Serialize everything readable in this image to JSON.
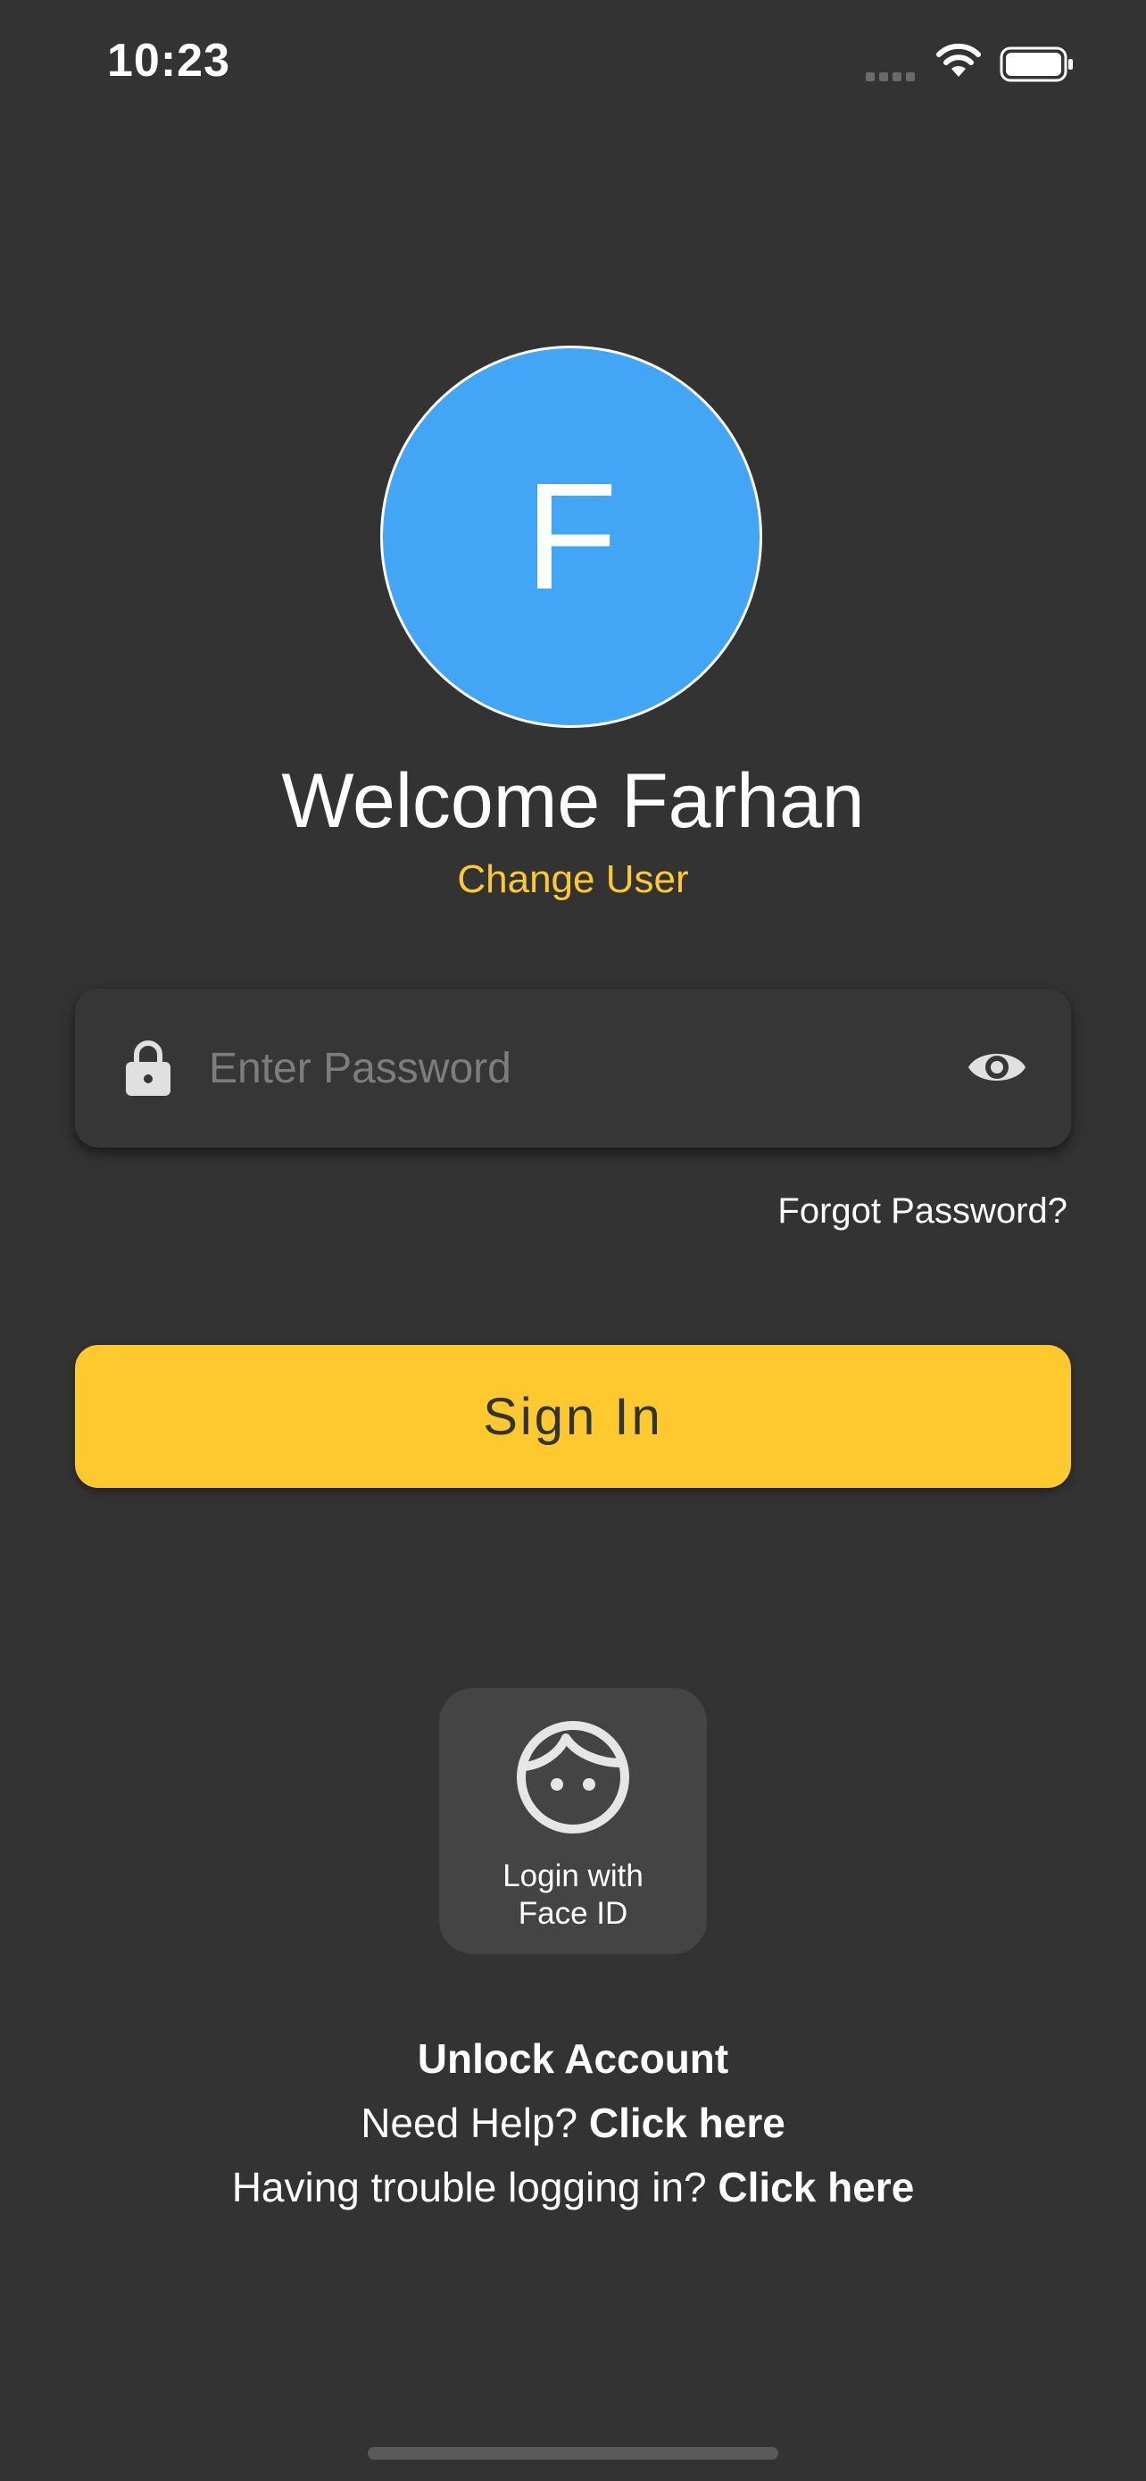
{
  "status_bar": {
    "time": "10:23",
    "signal_icon": "cellular-signal-icon",
    "wifi_icon": "wifi-icon",
    "battery_icon": "battery-full-icon"
  },
  "profile": {
    "initial": "F",
    "avatar_color": "#42a5f5",
    "welcome_text": "Welcome Farhan",
    "change_user_label": "Change User"
  },
  "password": {
    "placeholder": "Enter Password",
    "value": "",
    "lock_icon": "lock-icon",
    "visibility_icon": "eye-icon"
  },
  "forgot_password_label": "Forgot Password?",
  "sign_in_label": "Sign In",
  "face_id": {
    "icon": "face-icon",
    "label": "Login with\nFace ID"
  },
  "footer": {
    "unlock_label": "Unlock Account",
    "help_prefix": "Need Help?",
    "help_link": "Click here",
    "trouble_prefix": "Having trouble logging in?",
    "trouble_link": "Click here"
  },
  "colors": {
    "background": "#333333",
    "accent": "#fdc92f",
    "field_background": "#363636",
    "card_background": "#444444"
  }
}
